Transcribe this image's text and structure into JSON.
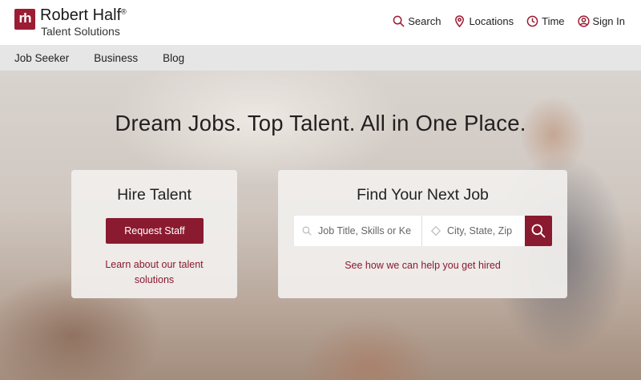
{
  "brand": {
    "mark": "rh",
    "name": "Robert Half",
    "registered": "®",
    "sub": "Talent Solutions",
    "color": "#9b1c33"
  },
  "utility_nav": [
    {
      "label": "Search",
      "icon": "search-icon"
    },
    {
      "label": "Locations",
      "icon": "location-pin-icon"
    },
    {
      "label": "Time",
      "icon": "clock-icon"
    },
    {
      "label": "Sign In",
      "icon": "user-icon"
    }
  ],
  "main_nav": [
    "Job Seeker",
    "Business",
    "Blog"
  ],
  "hero": {
    "headline": "Dream Jobs. Top Talent. All in One Place."
  },
  "hire_card": {
    "title": "Hire Talent",
    "button_label": "Request Staff",
    "link_text": "Learn about our talent solutions"
  },
  "find_card": {
    "title": "Find Your Next Job",
    "title_placeholder": "Job Title, Skills or Keywords",
    "location_placeholder": "City, State, Zip",
    "link_text": "See how we can help you get hired"
  },
  "colors": {
    "accent": "#8a1a2f",
    "nav_bg": "#e6e6e6"
  }
}
